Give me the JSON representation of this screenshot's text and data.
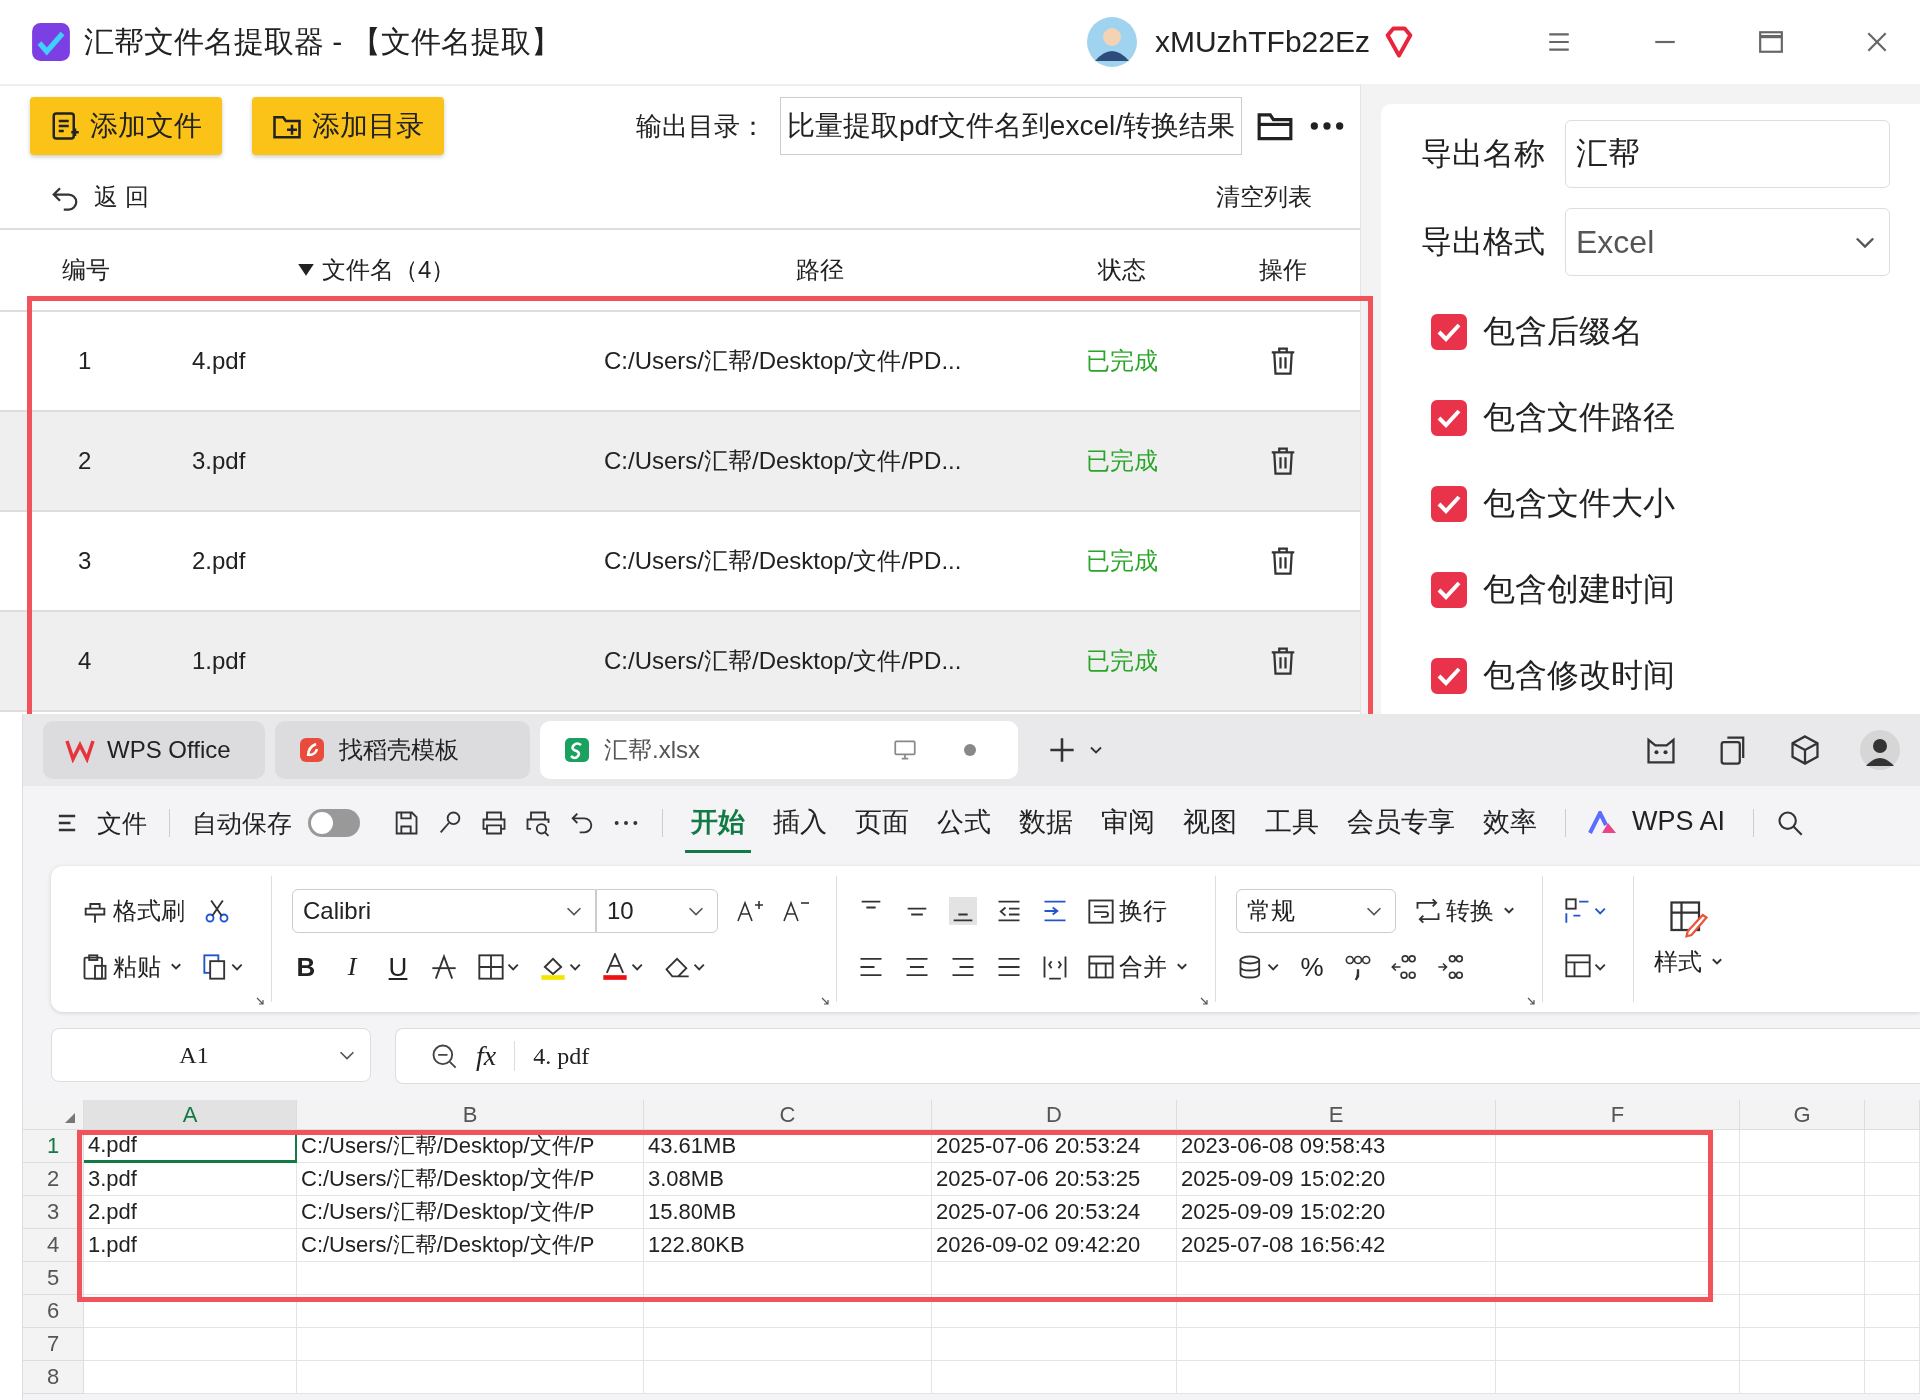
{
  "window": {
    "title": "汇帮文件名提取器 - 【文件名提取】",
    "user": "xMUzhTFb22Ez"
  },
  "toolbar": {
    "buttons": [
      {
        "label": "添加文件",
        "kind": "file"
      },
      {
        "label": "添加目录",
        "kind": "folder"
      }
    ],
    "output_label": "输出目录：",
    "output_path": "比量提取pdf文件名到excel/转换结果",
    "back": "返 回",
    "clear": "清空列表"
  },
  "table": {
    "columns": [
      {
        "label": "编号",
        "sorted": false
      },
      {
        "label": "文件名（4）",
        "sorted": true
      },
      {
        "label": "路径",
        "sorted": false
      },
      {
        "label": "状态",
        "sorted": false
      },
      {
        "label": "操作",
        "sorted": false
      }
    ],
    "rows": [
      {
        "no": "1",
        "name": "4.pdf",
        "path": "C:/Users/汇帮/Desktop/文件/PD...",
        "status": "已完成"
      },
      {
        "no": "2",
        "name": "3.pdf",
        "path": "C:/Users/汇帮/Desktop/文件/PD...",
        "status": "已完成"
      },
      {
        "no": "3",
        "name": "2.pdf",
        "path": "C:/Users/汇帮/Desktop/文件/PD...",
        "status": "已完成"
      },
      {
        "no": "4",
        "name": "1.pdf",
        "path": "C:/Users/汇帮/Desktop/文件/PD...",
        "status": "已完成"
      }
    ]
  },
  "export": {
    "name_label": "导出名称",
    "name_value": "汇帮",
    "format_label": "导出格式",
    "format_value": "Excel",
    "options": [
      {
        "label": "包含后缀名",
        "checked": true
      },
      {
        "label": "包含文件路径",
        "checked": true
      },
      {
        "label": "包含文件大小",
        "checked": true
      },
      {
        "label": "包含创建时间",
        "checked": true
      },
      {
        "label": "包含修改时间",
        "checked": true
      }
    ]
  },
  "wps": {
    "tabs": [
      {
        "label": "WPS Office",
        "kind": "home",
        "selected": false
      },
      {
        "label": "找稻壳模板",
        "kind": "template",
        "selected": false
      },
      {
        "label": "汇帮.xlsx",
        "kind": "sheet",
        "selected": true
      }
    ],
    "file_menu": "文件",
    "autosave": {
      "label": "自动保存",
      "on": false
    },
    "ribbon_tabs": [
      {
        "label": "开始",
        "selected": true
      },
      {
        "label": "插入",
        "selected": false
      },
      {
        "label": "页面",
        "selected": false
      },
      {
        "label": "公式",
        "selected": false
      },
      {
        "label": "数据",
        "selected": false
      },
      {
        "label": "审阅",
        "selected": false
      },
      {
        "label": "视图",
        "selected": false
      },
      {
        "label": "工具",
        "selected": false
      },
      {
        "label": "会员专享",
        "selected": false
      },
      {
        "label": "效率",
        "selected": false
      }
    ],
    "ai": "WPS AI",
    "ribbon": {
      "format_painter": "格式刷",
      "paste": "粘贴",
      "font": "Calibri",
      "size": "10",
      "bold": "B",
      "italic": "I",
      "underline": "U",
      "wrap": "换行",
      "merge": "合并",
      "number_format": "常规",
      "convert": "转换",
      "percent": "%",
      "styles": "样式"
    },
    "formula_bar": {
      "cell": "A1",
      "fx": "fx",
      "formula": "4. pdf"
    },
    "sheet": {
      "columns": [
        {
          "label": "A",
          "selected": true
        },
        {
          "label": "B",
          "selected": false
        },
        {
          "label": "C",
          "selected": false
        },
        {
          "label": "D",
          "selected": false
        },
        {
          "label": "E",
          "selected": false
        },
        {
          "label": "F",
          "selected": false
        },
        {
          "label": "G",
          "selected": false
        }
      ],
      "rows": [
        {
          "label": "1",
          "selected": true,
          "cells": [
            "4.pdf",
            "C:/Users/汇帮/Desktop/文件/P",
            "43.61MB",
            "2025-07-06 20:53:24",
            "2023-06-08 09:58:43"
          ]
        },
        {
          "label": "2",
          "selected": false,
          "cells": [
            "3.pdf",
            "C:/Users/汇帮/Desktop/文件/P",
            "3.08MB",
            "2025-07-06 20:53:25",
            "2025-09-09 15:02:20"
          ]
        },
        {
          "label": "3",
          "selected": false,
          "cells": [
            "2.pdf",
            "C:/Users/汇帮/Desktop/文件/P",
            "15.80MB",
            "2025-07-06 20:53:24",
            "2025-09-09 15:02:20"
          ]
        },
        {
          "label": "4",
          "selected": false,
          "cells": [
            "1.pdf",
            "C:/Users/汇帮/Desktop/文件/P",
            "122.80KB",
            "2026-09-02 09:42:20",
            "2025-07-08 16:56:42"
          ]
        },
        {
          "label": "5",
          "selected": false
        },
        {
          "label": "6",
          "selected": false
        },
        {
          "label": "7",
          "selected": false
        },
        {
          "label": "8",
          "selected": false
        }
      ]
    }
  }
}
